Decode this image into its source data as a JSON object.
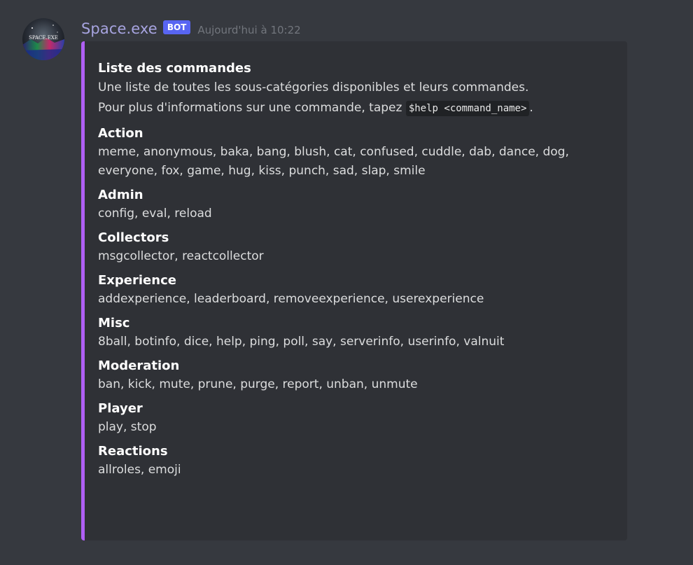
{
  "message": {
    "username": "Space.exe",
    "bot_tag": "BOT",
    "timestamp": "Aujourd'hui à 10:22",
    "avatar_text": "SPACE.EXE"
  },
  "embed": {
    "accent_color": "#b05ff5",
    "title": "Liste des commandes",
    "description_line1": "Une liste de toutes les sous-catégories disponibles et leurs commandes.",
    "description_line2_prefix": "Pour plus d'informations sur une commande, tapez ",
    "description_code": "$help <command_name>",
    "description_line2_suffix": ".",
    "fields": [
      {
        "name": "Action",
        "value_lines": [
          "meme, anonymous, baka, bang, blush, cat, confused, cuddle, dab, dance, dog,",
          "everyone, fox, game, hug, kiss, punch, sad, slap, smile"
        ]
      },
      {
        "name": "Admin",
        "value_lines": [
          "config, eval, reload"
        ]
      },
      {
        "name": "Collectors",
        "value_lines": [
          "msgcollector, reactcollector"
        ]
      },
      {
        "name": "Experience",
        "value_lines": [
          "addexperience, leaderboard, removeexperience, userexperience"
        ]
      },
      {
        "name": "Misc",
        "value_lines": [
          "8ball, botinfo, dice, help, ping, poll, say, serverinfo, userinfo, valnuit"
        ]
      },
      {
        "name": "Moderation",
        "value_lines": [
          "ban, kick, mute, prune, purge, report, unban, unmute"
        ]
      },
      {
        "name": "Player",
        "value_lines": [
          "play, stop"
        ]
      },
      {
        "name": "Reactions",
        "value_lines": [
          "allroles, emoji"
        ]
      }
    ]
  }
}
